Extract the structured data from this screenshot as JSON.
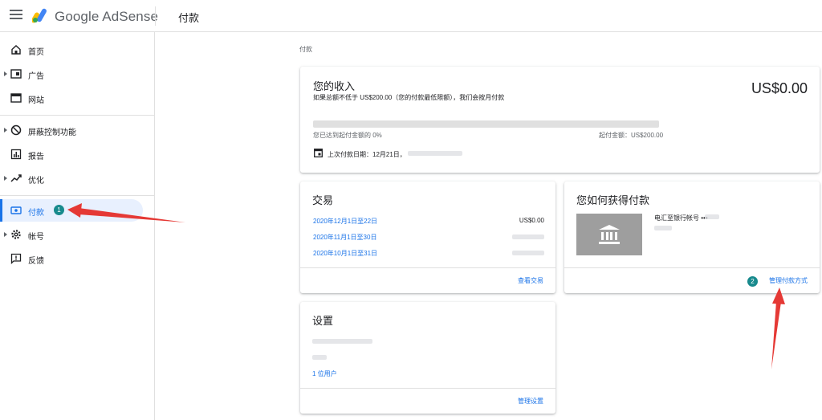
{
  "topbar": {
    "brand": "Google AdSense",
    "page_title": "付款",
    "logo_colors": {
      "blue": "#4285f4",
      "yellow": "#fbbc04",
      "green": "#34a853"
    }
  },
  "sidebar": {
    "items": [
      {
        "label": "首页",
        "icon": "home-icon",
        "caret": false
      },
      {
        "label": "广告",
        "icon": "ads-icon",
        "caret": true
      },
      {
        "label": "网站",
        "icon": "sites-icon",
        "caret": false
      },
      {
        "label": "屏蔽控制功能",
        "icon": "block-icon",
        "caret": true
      },
      {
        "label": "报告",
        "icon": "reports-icon",
        "caret": false
      },
      {
        "label": "优化",
        "icon": "trend-icon",
        "caret": true
      },
      {
        "label": "付款",
        "icon": "payments-icon",
        "caret": false,
        "active": true,
        "badge": "1"
      },
      {
        "label": "帐号",
        "icon": "gear-icon",
        "caret": true
      },
      {
        "label": "反馈",
        "icon": "feedback-icon",
        "caret": false
      }
    ]
  },
  "main": {
    "breadcrumb": "付款",
    "earnings": {
      "title": "您的收入",
      "subtitle": "如果总额不低于 US$200.00（您的付款最低限额），我们会按月付款",
      "amount": "US$0.00",
      "progress_left": "您已达到起付金额的 0%",
      "progress_right": "起付金额：US$200.00",
      "progress_fraction": 0,
      "last_payment": "上次付款日期：12月21日，"
    },
    "transactions": {
      "title": "交易",
      "rows": [
        {
          "date": "2020年12月1日至22日",
          "amount": "US$0.00"
        },
        {
          "date": "2020年11月1日至30日",
          "amount": ""
        },
        {
          "date": "2020年10月1日至31日",
          "amount": ""
        }
      ],
      "footer_link": "查看交易"
    },
    "payment_method": {
      "title": "您如何获得付款",
      "method": "电汇至银行帐号 •••",
      "footer_link": "管理付款方式",
      "badge": "2"
    },
    "settings": {
      "title": "设置",
      "users_link": "1 位用户",
      "footer_link": "管理设置"
    }
  },
  "colors": {
    "accent": "#1a73e8",
    "badge": "#188a8d",
    "arrow": "#e53935"
  }
}
